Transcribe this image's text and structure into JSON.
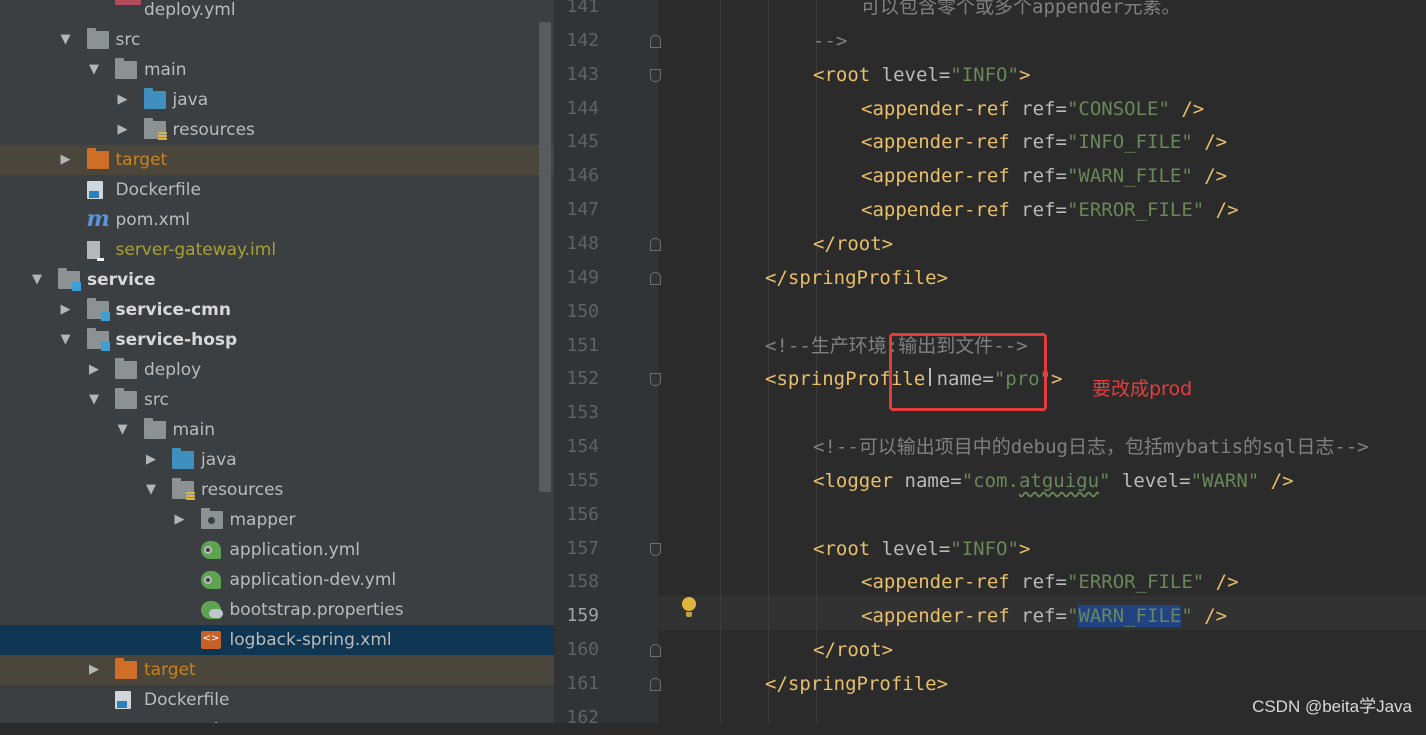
{
  "project_tree": {
    "rows": [
      {
        "label": "deploy.yml",
        "depth": 2,
        "icon": "yml-icon",
        "arrow": "",
        "style": ""
      },
      {
        "label": "src",
        "depth": 1,
        "icon": "folder-icon",
        "arrow": "expanded",
        "style": ""
      },
      {
        "label": "main",
        "depth": 2,
        "icon": "folder-icon",
        "arrow": "expanded",
        "style": ""
      },
      {
        "label": "java",
        "depth": 3,
        "icon": "source-folder-icon",
        "arrow": "collapsed",
        "style": ""
      },
      {
        "label": "resources",
        "depth": 3,
        "icon": "resources-folder-icon",
        "arrow": "collapsed",
        "style": ""
      },
      {
        "label": "target",
        "depth": 1,
        "icon": "excluded-folder-icon",
        "arrow": "collapsed",
        "style": "target"
      },
      {
        "label": "Dockerfile",
        "depth": 1,
        "icon": "docker-file-icon",
        "arrow": "",
        "style": ""
      },
      {
        "label": "pom.xml",
        "depth": 1,
        "icon": "maven-icon",
        "arrow": "",
        "style": ""
      },
      {
        "label": "server-gateway.iml",
        "depth": 1,
        "icon": "iml-file-icon",
        "arrow": "",
        "style": "iml"
      },
      {
        "label": "service",
        "depth": 0,
        "icon": "module-folder-icon",
        "arrow": "expanded",
        "style": "module"
      },
      {
        "label": "service-cmn",
        "depth": 1,
        "icon": "module-folder-icon",
        "arrow": "collapsed",
        "style": "module"
      },
      {
        "label": "service-hosp",
        "depth": 1,
        "icon": "module-folder-icon",
        "arrow": "expanded",
        "style": "module"
      },
      {
        "label": "deploy",
        "depth": 2,
        "icon": "folder-icon",
        "arrow": "collapsed",
        "style": ""
      },
      {
        "label": "src",
        "depth": 2,
        "icon": "folder-icon",
        "arrow": "expanded",
        "style": ""
      },
      {
        "label": "main",
        "depth": 3,
        "icon": "folder-icon",
        "arrow": "expanded",
        "style": ""
      },
      {
        "label": "java",
        "depth": 4,
        "icon": "source-folder-icon",
        "arrow": "collapsed",
        "style": ""
      },
      {
        "label": "resources",
        "depth": 4,
        "icon": "resources-folder-icon",
        "arrow": "expanded",
        "style": ""
      },
      {
        "label": "mapper",
        "depth": 5,
        "icon": "package-folder-icon",
        "arrow": "collapsed",
        "style": ""
      },
      {
        "label": "application.yml",
        "depth": 5,
        "icon": "spring-yml-icon",
        "arrow": "",
        "style": ""
      },
      {
        "label": "application-dev.yml",
        "depth": 5,
        "icon": "spring-yml-icon",
        "arrow": "",
        "style": ""
      },
      {
        "label": "bootstrap.properties",
        "depth": 5,
        "icon": "spring-properties-icon",
        "arrow": "",
        "style": ""
      },
      {
        "label": "logback-spring.xml",
        "depth": 5,
        "icon": "xml-file-icon",
        "arrow": "",
        "style": "selected"
      },
      {
        "label": "target",
        "depth": 2,
        "icon": "excluded-folder-icon",
        "arrow": "collapsed",
        "style": "target"
      },
      {
        "label": "Dockerfile",
        "depth": 2,
        "icon": "docker-file-icon",
        "arrow": "",
        "style": ""
      },
      {
        "label": "pom.xml",
        "depth": 2,
        "icon": "maven-icon",
        "arrow": "",
        "style": ""
      }
    ]
  },
  "editor": {
    "current_line": "159",
    "lines": [
      {
        "num": "141",
        "indent": 3,
        "tokens": [
          {
            "t": "可以包含零个或多个appender元素。",
            "c": "cmt"
          }
        ]
      },
      {
        "num": "142",
        "indent": 2,
        "fold": "up",
        "tokens": [
          {
            "t": "-->",
            "c": "cmt"
          }
        ]
      },
      {
        "num": "143",
        "indent": 2,
        "fold": "down",
        "tokens": [
          {
            "t": "<root ",
            "c": "tag"
          },
          {
            "t": "level",
            "c": "attr"
          },
          {
            "t": "=",
            "c": "attr"
          },
          {
            "t": "\"INFO\"",
            "c": "val"
          },
          {
            "t": ">",
            "c": "tag"
          }
        ]
      },
      {
        "num": "144",
        "indent": 3,
        "tokens": [
          {
            "t": "<appender-ref ",
            "c": "tag"
          },
          {
            "t": "ref",
            "c": "attr"
          },
          {
            "t": "=",
            "c": "attr"
          },
          {
            "t": "\"CONSOLE\"",
            "c": "val"
          },
          {
            "t": " />",
            "c": "tag"
          }
        ]
      },
      {
        "num": "145",
        "indent": 3,
        "tokens": [
          {
            "t": "<appender-ref ",
            "c": "tag"
          },
          {
            "t": "ref",
            "c": "attr"
          },
          {
            "t": "=",
            "c": "attr"
          },
          {
            "t": "\"INFO_FILE\"",
            "c": "val"
          },
          {
            "t": " />",
            "c": "tag"
          }
        ]
      },
      {
        "num": "146",
        "indent": 3,
        "tokens": [
          {
            "t": "<appender-ref ",
            "c": "tag"
          },
          {
            "t": "ref",
            "c": "attr"
          },
          {
            "t": "=",
            "c": "attr"
          },
          {
            "t": "\"WARN_FILE\"",
            "c": "val"
          },
          {
            "t": " />",
            "c": "tag"
          }
        ]
      },
      {
        "num": "147",
        "indent": 3,
        "tokens": [
          {
            "t": "<appender-ref ",
            "c": "tag"
          },
          {
            "t": "ref",
            "c": "attr"
          },
          {
            "t": "=",
            "c": "attr"
          },
          {
            "t": "\"ERROR_FILE\"",
            "c": "val"
          },
          {
            "t": " />",
            "c": "tag"
          }
        ]
      },
      {
        "num": "148",
        "indent": 2,
        "fold": "up",
        "tokens": [
          {
            "t": "</root>",
            "c": "tag"
          }
        ]
      },
      {
        "num": "149",
        "indent": 1,
        "fold": "up",
        "tokens": [
          {
            "t": "</springProfile>",
            "c": "tag"
          }
        ]
      },
      {
        "num": "150",
        "indent": 0,
        "tokens": []
      },
      {
        "num": "151",
        "indent": 1,
        "tokens": [
          {
            "t": "<!--生产环境:输出到文件-->",
            "c": "cmt"
          }
        ]
      },
      {
        "num": "152",
        "indent": 1,
        "fold": "down",
        "tokens": [
          {
            "t": "<springProfile ",
            "c": "tag"
          },
          {
            "t": "name",
            "c": "attr"
          },
          {
            "t": "=",
            "c": "attr"
          },
          {
            "t": "\"pro\"",
            "c": "val"
          },
          {
            "t": ">",
            "c": "tag"
          }
        ]
      },
      {
        "num": "153",
        "indent": 0,
        "tokens": []
      },
      {
        "num": "154",
        "indent": 2,
        "tokens": [
          {
            "t": "<!--可以输出项目中的debug日志，包括mybatis的sql日志-->",
            "c": "cmt"
          }
        ]
      },
      {
        "num": "155",
        "indent": 2,
        "tokens": [
          {
            "t": "<logger ",
            "c": "tag"
          },
          {
            "t": "name",
            "c": "attr"
          },
          {
            "t": "=",
            "c": "attr"
          },
          {
            "t": "\"com.",
            "c": "val"
          },
          {
            "t": "atguigu",
            "c": "val squig"
          },
          {
            "t": "\"",
            "c": "val"
          },
          {
            "t": " level",
            "c": "attr"
          },
          {
            "t": "=",
            "c": "attr"
          },
          {
            "t": "\"WARN\"",
            "c": "val"
          },
          {
            "t": " />",
            "c": "tag"
          }
        ]
      },
      {
        "num": "156",
        "indent": 0,
        "tokens": []
      },
      {
        "num": "157",
        "indent": 2,
        "fold": "down",
        "tokens": [
          {
            "t": "<root ",
            "c": "tag"
          },
          {
            "t": "level",
            "c": "attr"
          },
          {
            "t": "=",
            "c": "attr"
          },
          {
            "t": "\"INFO\"",
            "c": "val"
          },
          {
            "t": ">",
            "c": "tag"
          }
        ]
      },
      {
        "num": "158",
        "indent": 3,
        "tokens": [
          {
            "t": "<appender-ref ",
            "c": "tag"
          },
          {
            "t": "ref",
            "c": "attr"
          },
          {
            "t": "=",
            "c": "attr"
          },
          {
            "t": "\"ERROR_FILE\"",
            "c": "val"
          },
          {
            "t": " />",
            "c": "tag"
          }
        ]
      },
      {
        "num": "159",
        "indent": 3,
        "tokens": [
          {
            "t": "<appender-ref ",
            "c": "tag"
          },
          {
            "t": "ref",
            "c": "attr"
          },
          {
            "t": "=",
            "c": "attr"
          },
          {
            "t": "\"",
            "c": "val"
          },
          {
            "t": "WARN_FILE",
            "c": "val sel"
          },
          {
            "t": "\"",
            "c": "val"
          },
          {
            "t": " />",
            "c": "tag"
          }
        ]
      },
      {
        "num": "160",
        "indent": 2,
        "fold": "up",
        "tokens": [
          {
            "t": "</root>",
            "c": "tag"
          }
        ]
      },
      {
        "num": "161",
        "indent": 1,
        "fold": "up",
        "tokens": [
          {
            "t": "</springProfile>",
            "c": "tag"
          }
        ]
      },
      {
        "num": "162",
        "indent": 0,
        "tokens": []
      }
    ]
  },
  "annotation": {
    "text": "要改成prod"
  },
  "watermark": {
    "text": "CSDN @beita学Java"
  },
  "colors": {
    "tag": "#e8bf6a",
    "attribute": "#bababa",
    "string": "#6a8759",
    "comment": "#808080",
    "annotation": "#e23b3b",
    "selection": "#214283"
  }
}
